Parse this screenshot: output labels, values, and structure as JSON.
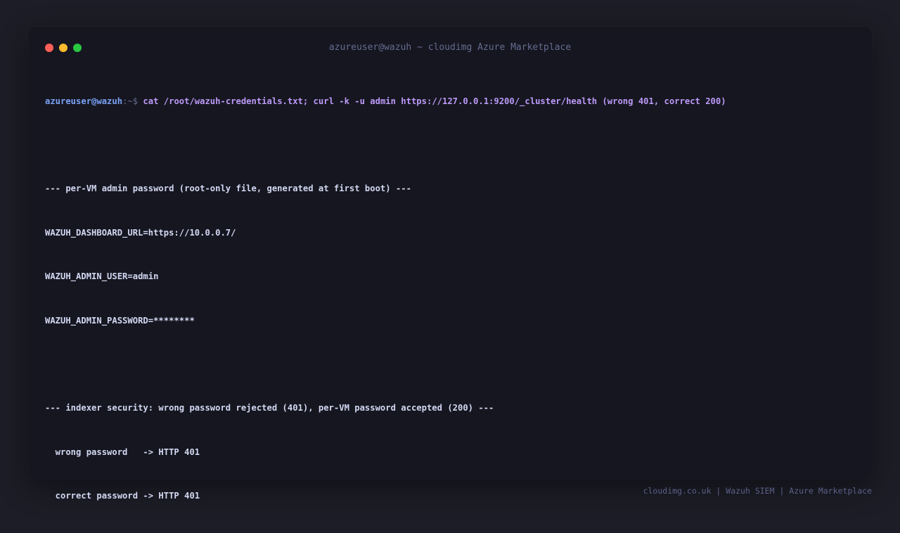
{
  "window": {
    "title": "azureuser@wazuh ~ cloudimg Azure Marketplace"
  },
  "terminal": {
    "prompt": {
      "user_host": "azureuser@wazuh",
      "path_symbol": ":~$",
      "command": "cat /root/wazuh-credentials.txt; curl -k -u admin https://127.0.0.1:9200/_cluster/health (wrong 401, correct 200)"
    },
    "lines": [
      "",
      "--- per-VM admin password (root-only file, generated at first boot) ---",
      "WAZUH_DASHBOARD_URL=https://10.0.0.7/",
      "WAZUH_ADMIN_USER=admin",
      "WAZUH_ADMIN_PASSWORD=********",
      "",
      "--- indexer security: wrong password rejected (401), per-VM password accepted (200) ---",
      "  wrong password   -> HTTP 401",
      "  correct password -> HTTP 401"
    ]
  },
  "footer": {
    "text": "cloudimg.co.uk | Wazuh SIEM | Azure Marketplace"
  },
  "colors": {
    "page_background": "#1d1d27",
    "terminal_background": "#161620",
    "prompt_user": "#7aa2f7",
    "command": "#bb9af7",
    "output_text": "#d2d8f2",
    "dot_close": "#ff5f57",
    "dot_minimize": "#febc2e",
    "dot_maximize": "#28c840"
  }
}
